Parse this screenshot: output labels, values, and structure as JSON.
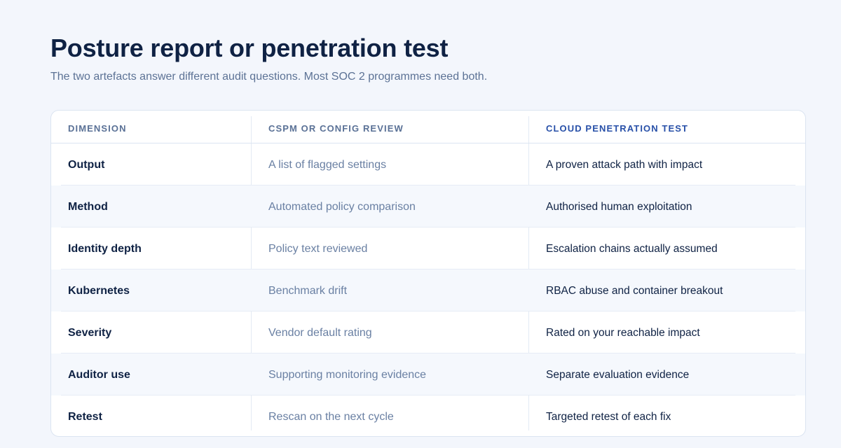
{
  "header": {
    "title": "Posture report or penetration test",
    "subtitle": "The two artefacts answer different audit questions. Most SOC 2 programmes need both."
  },
  "table": {
    "columns": [
      "Dimension",
      "CSPM or config review",
      "Cloud penetration test"
    ],
    "rows": [
      [
        "Output",
        "A list of flagged settings",
        "A proven attack path with impact"
      ],
      [
        "Method",
        "Automated policy comparison",
        "Authorised human exploitation"
      ],
      [
        "Identity depth",
        "Policy text reviewed",
        "Escalation chains actually assumed"
      ],
      [
        "Kubernetes",
        "Benchmark drift",
        "RBAC abuse and container breakout"
      ],
      [
        "Severity",
        "Vendor default rating",
        "Rated on your reachable impact"
      ],
      [
        "Auditor use",
        "Supporting monitoring evidence",
        "Separate evaluation evidence"
      ],
      [
        "Retest",
        "Rescan on the next cycle",
        "Targeted retest of each fix"
      ]
    ]
  },
  "colors": {
    "background": "#f3f6fc",
    "title": "#0f2244",
    "muted": "#5c7295",
    "accent": "#2850a8"
  }
}
